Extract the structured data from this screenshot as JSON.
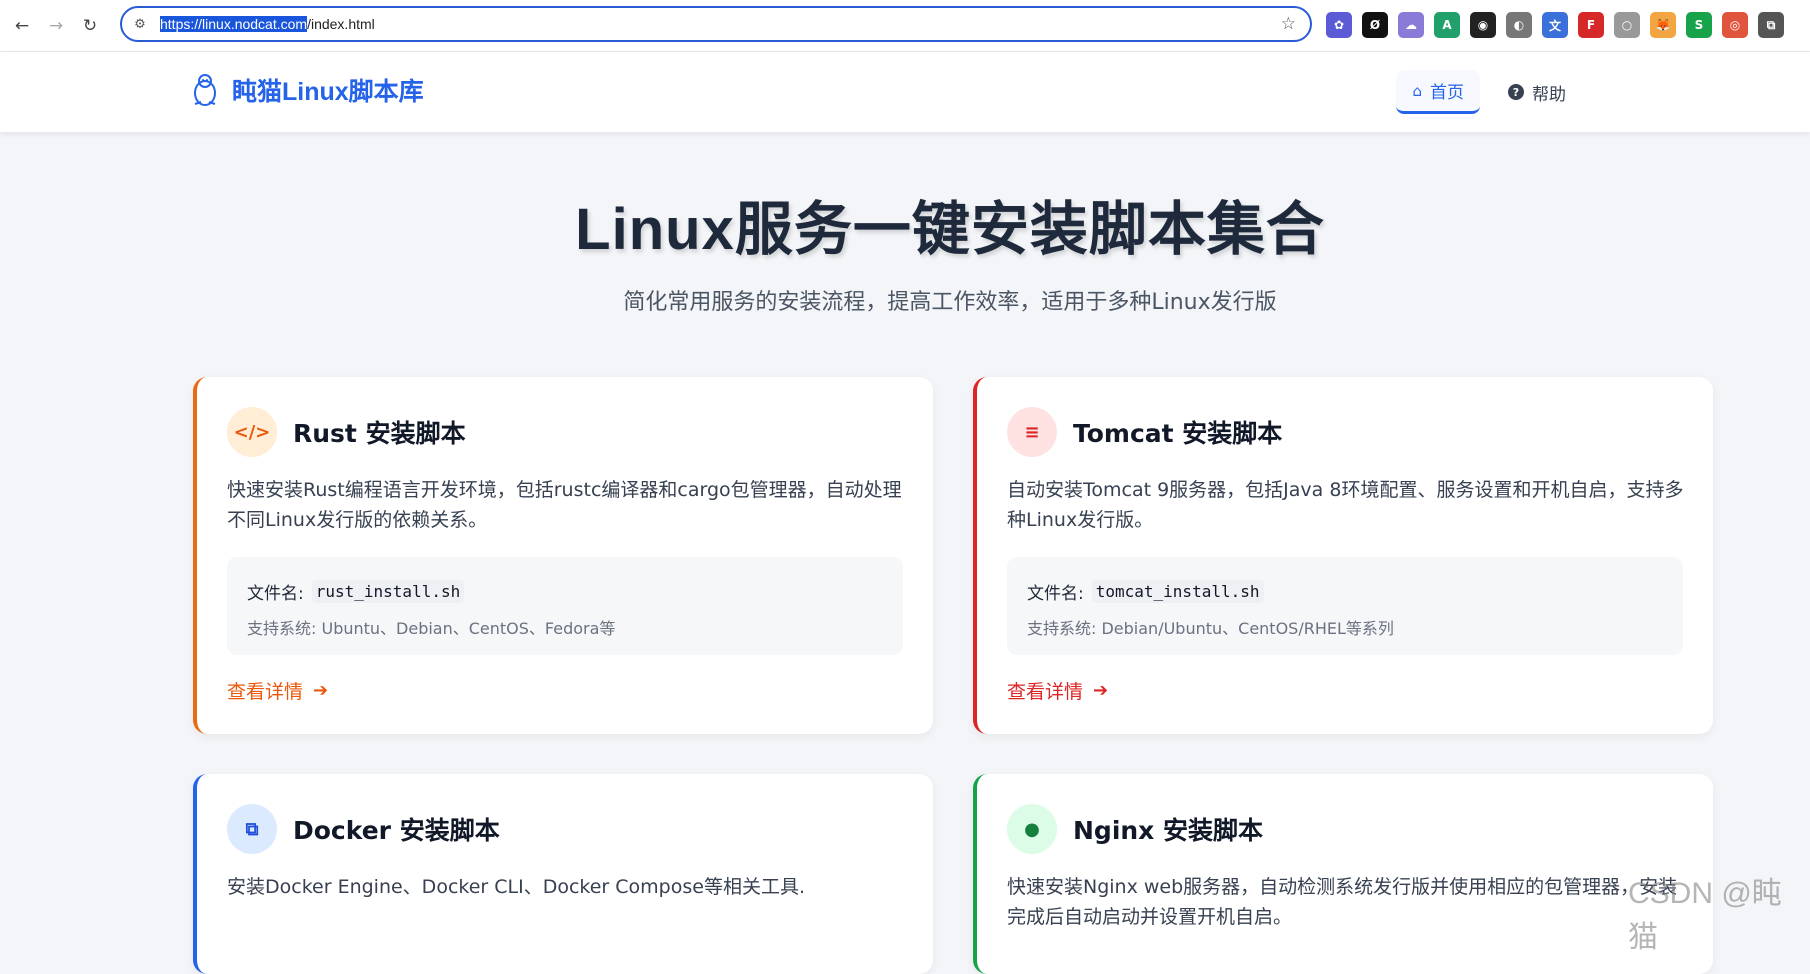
{
  "browser": {
    "url_selected": "https://linux.nodcat.com",
    "url_rest": "/index.html",
    "back_icon": "←",
    "forward_icon": "→",
    "reload_icon": "↻",
    "site_info_icon": "⚙",
    "bookmark_icon": "☆",
    "extensions": [
      {
        "name": "ext-1",
        "glyph": "✿",
        "color": "#5b5bd6"
      },
      {
        "name": "ext-2",
        "glyph": "Ø",
        "color": "#111111"
      },
      {
        "name": "ext-3",
        "glyph": "☁",
        "color": "#8b7bd8"
      },
      {
        "name": "ext-4",
        "glyph": "A",
        "color": "#22a06b"
      },
      {
        "name": "ext-5",
        "glyph": "◉",
        "color": "#222222"
      },
      {
        "name": "ext-6",
        "glyph": "◐",
        "color": "#777777"
      },
      {
        "name": "ext-7",
        "glyph": "文",
        "color": "#3b6fd9"
      },
      {
        "name": "ext-8",
        "glyph": "F",
        "color": "#d62828"
      },
      {
        "name": "ext-9",
        "glyph": "○",
        "color": "#999999"
      },
      {
        "name": "ext-10",
        "glyph": "🦊",
        "color": "#f2a541"
      },
      {
        "name": "ext-11",
        "glyph": "S",
        "color": "#16a34a"
      },
      {
        "name": "ext-12",
        "glyph": "◎",
        "color": "#e0533d"
      },
      {
        "name": "ext-13",
        "glyph": "⧉",
        "color": "#555555"
      }
    ]
  },
  "site": {
    "brand": "盹猫Linux脚本库",
    "menu": [
      {
        "label": "首页",
        "icon": "⌂",
        "active": true
      },
      {
        "label": "帮助",
        "icon": "?",
        "active": false
      }
    ]
  },
  "hero": {
    "title": "Linux服务一键安装脚本集合",
    "subtitle": "简化常用服务的安装流程，提高工作效率，适用于多种Linux发行版"
  },
  "cards": [
    {
      "title": "Rust 安装脚本",
      "icon": "</>",
      "description": "快速安装Rust编程语言开发环境，包括rustc编译器和cargo包管理器，自动处理不同Linux发行版的依赖关系。",
      "file_label": "文件名:",
      "file_name": "rust_install.sh",
      "systems": "支持系统: Ubuntu、Debian、CentOS、Fedora等",
      "details": "查看详情",
      "accent": "#ea580c"
    },
    {
      "title": "Tomcat 安装脚本",
      "icon": "≡",
      "description": "自动安装Tomcat 9服务器，包括Java 8环境配置、服务设置和开机自启，支持多种Linux发行版。",
      "file_label": "文件名:",
      "file_name": "tomcat_install.sh",
      "systems": "支持系统: Debian/Ubuntu、CentOS/RHEL等系列",
      "details": "查看详情",
      "accent": "#dc2626"
    },
    {
      "title": "Docker 安装脚本",
      "icon": "⧉",
      "description": "安装Docker Engine、Docker CLI、Docker Compose等相关工具.",
      "accent": "#2563eb"
    },
    {
      "title": "Nginx 安装脚本",
      "icon": "●",
      "description": "快速安装Nginx web服务器，自动检测系统发行版并使用相应的包管理器，安装完成后自动启动并设置开机自启。",
      "accent": "#16a34a"
    }
  ],
  "watermark": "CSDN @盹猫"
}
